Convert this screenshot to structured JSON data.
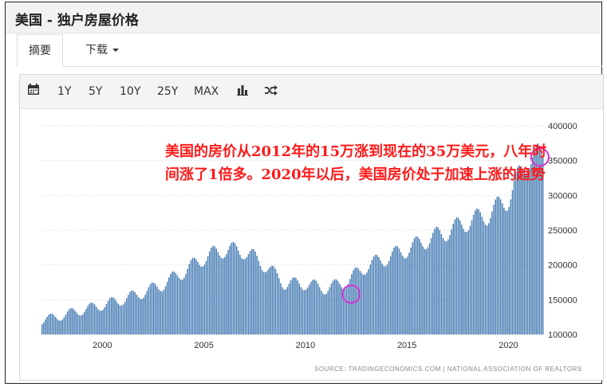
{
  "header": {
    "title": "美国 - 独户房屋价格"
  },
  "tabs": [
    {
      "label": "摘要"
    },
    {
      "label": "下载"
    }
  ],
  "toolbar": {
    "calendar_icon": "calendar-icon",
    "ranges": [
      "1Y",
      "5Y",
      "10Y",
      "25Y",
      "MAX"
    ],
    "bar_chart_icon": "bar-chart-icon",
    "shuffle_icon": "shuffle-icon"
  },
  "annotation": "美国的房价从2012年的15万涨到现在的35万美元，八年时间涨了1倍多。2020年以后，美国房价处于加速上涨的趋势",
  "source": "SOURCE: TRADINGECONOMICS.COM  |  NATIONAL ASSOCIATION OF REALTORS",
  "colors": {
    "bar": "#4a7fb5",
    "annotation": "#ff1a1a",
    "circle": "#d633d6"
  },
  "chart_data": {
    "type": "bar",
    "ylim": [
      100000,
      400000
    ],
    "yticks": [
      "400000",
      "350000",
      "300000",
      "250000",
      "200000",
      "150000",
      "100000"
    ],
    "xticks": [
      "2000",
      "2005",
      "2010",
      "2015",
      "2020"
    ],
    "y_axis_position": "right",
    "grid": "dotted",
    "x": [
      "1997",
      "1998",
      "1999",
      "2000",
      "2001",
      "2002",
      "2003",
      "2004",
      "2005",
      "2006",
      "2007",
      "2008",
      "2009",
      "2010",
      "2011",
      "2012",
      "2013",
      "2014",
      "2015",
      "2016",
      "2017",
      "2018",
      "2019",
      "2020",
      "2021"
    ],
    "values": [
      120000,
      127000,
      135000,
      142000,
      150000,
      160000,
      172000,
      190000,
      210000,
      222000,
      220000,
      200000,
      173000,
      173000,
      166000,
      175000,
      198000,
      210000,
      222000,
      236000,
      248000,
      262000,
      272000,
      295000,
      355000
    ],
    "highlights": [
      {
        "x": "2012",
        "y": 158000
      },
      {
        "x": "2021",
        "y": 355000
      }
    ]
  }
}
